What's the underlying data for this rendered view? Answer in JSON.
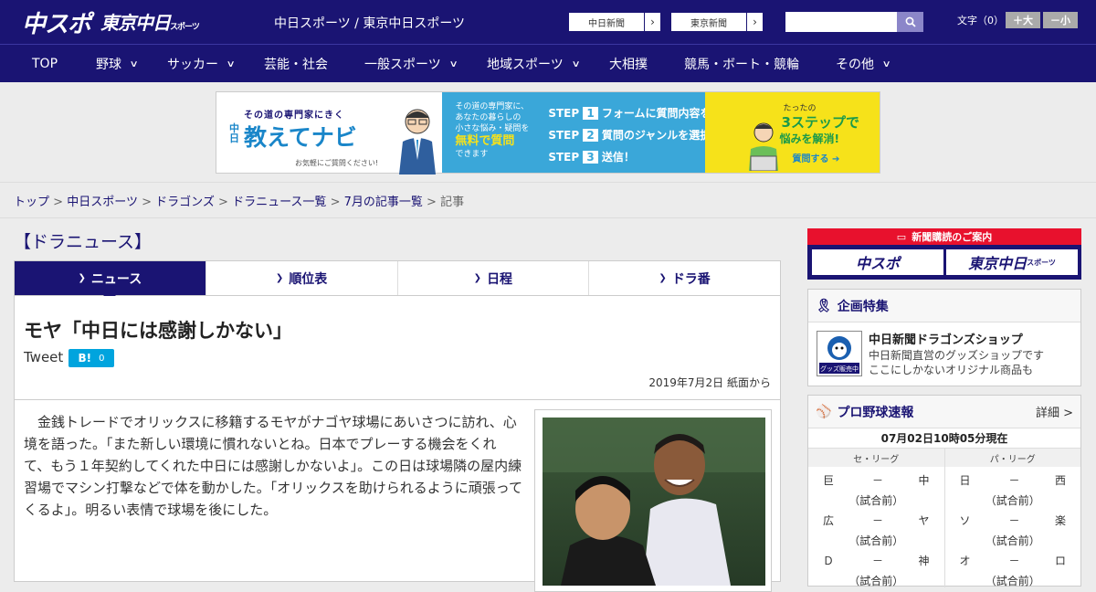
{
  "header": {
    "logo_main": "中スポ",
    "logo_tokyo": "東京中日",
    "logo_tokyo_sub": "スポーツ",
    "site_title": "中日スポーツ / 東京中日スポーツ",
    "link_chunichi": "中日新聞",
    "link_tokyo": "東京新聞",
    "search_placeholder": "",
    "font_size_label": "文字（0）",
    "font_larger": "＋大",
    "font_smaller": "－小"
  },
  "nav": {
    "items": [
      {
        "label": "TOP",
        "has_menu": false
      },
      {
        "label": "野球",
        "has_menu": true
      },
      {
        "label": "サッカー",
        "has_menu": true
      },
      {
        "label": "芸能・社会",
        "has_menu": false
      },
      {
        "label": "一般スポーツ",
        "has_menu": true
      },
      {
        "label": "地域スポーツ",
        "has_menu": true
      },
      {
        "label": "大相撲",
        "has_menu": false
      },
      {
        "label": "競馬・ボート・競輪",
        "has_menu": false
      },
      {
        "label": "その他",
        "has_menu": true
      }
    ]
  },
  "banner": {
    "tagline": "その道の専門家にきく",
    "brand": "教えてナビ",
    "brand_prefix": "中日",
    "note": "お気軽にご質問ください!",
    "lead_1": "その道の専門家に、",
    "lead_2": "あなたの暮らしの",
    "lead_3": "小さな悩み・疑問を",
    "lead_free": "無料で質問",
    "lead_4": "できます",
    "step1": "フォームに質問内容を入力",
    "step2": "質問のジャンルを選択",
    "step3": "送信！",
    "step_word": "STEP",
    "right_1": "たったの",
    "right_2": "3ステップで",
    "right_3": "悩みを解消!",
    "cta": "質問する"
  },
  "breadcrumb": {
    "items": [
      "トップ",
      "中日スポーツ",
      "ドラゴンズ",
      "ドラニュース一覧",
      "7月の記事一覧"
    ],
    "current": "記事",
    "sep": ">"
  },
  "section_title": "【ドラニュース】",
  "tabs": [
    "ニュース",
    "順位表",
    "日程",
    "ドラ番"
  ],
  "article": {
    "headline": "モヤ「中日には感謝しかない」",
    "tweet": "Tweet",
    "hatena_label": "B!",
    "hatena_count": "0",
    "date": "2019年7月2日 紙面から",
    "body": "金銭トレードでオリックスに移籍するモヤがナゴヤ球場にあいさつに訪れ、心境を語った。「また新しい環境に慣れないとね。日本でプレーする機会をくれて、もう１年契約してくれた中日には感謝しかないよ」。この日は球場隣の屋内練習場でマシン打撃などで体を動かした。「オリックスを助けられるように頑張ってくるよ」。明るい表情で球場を後にした。"
  },
  "sidebar": {
    "subscribe_title": "新聞購読のご案内",
    "subscribe_a": "中スポ",
    "subscribe_b": "東京中日",
    "subscribe_b_sub": "スポーツ",
    "special_title": "企画特集",
    "shop_title": "中日新聞ドラゴンズショップ",
    "shop_desc_1": "中日新聞直営のグッズショップです",
    "shop_desc_2": "ここにしかないオリジナル商品も",
    "shop_badge": "グッズ販売中",
    "scores_title": "プロ野球速報",
    "scores_more": "詳細 >",
    "scores_time": "07月02日10時05分現在",
    "central_label": "セ・リーグ",
    "pacific_label": "パ・リーグ",
    "central": [
      {
        "home": "巨",
        "dash": "－",
        "away": "中",
        "status": "（試合前）"
      },
      {
        "home": "広",
        "dash": "－",
        "away": "ヤ",
        "status": "（試合前）"
      },
      {
        "home": "Ｄ",
        "dash": "－",
        "away": "神",
        "status": "（試合前）"
      }
    ],
    "pacific": [
      {
        "home": "日",
        "dash": "－",
        "away": "西",
        "status": "（試合前）"
      },
      {
        "home": "ソ",
        "dash": "－",
        "away": "楽",
        "status": "（試合前）"
      },
      {
        "home": "オ",
        "dash": "－",
        "away": "ロ",
        "status": "（試合前）"
      }
    ]
  },
  "colors": {
    "brand_navy": "#1a1473",
    "subscribe_red": "#e8112d",
    "hatena_blue": "#00a4de",
    "banner_blue": "#3aa7d9",
    "banner_yellow": "#f6e21a"
  }
}
